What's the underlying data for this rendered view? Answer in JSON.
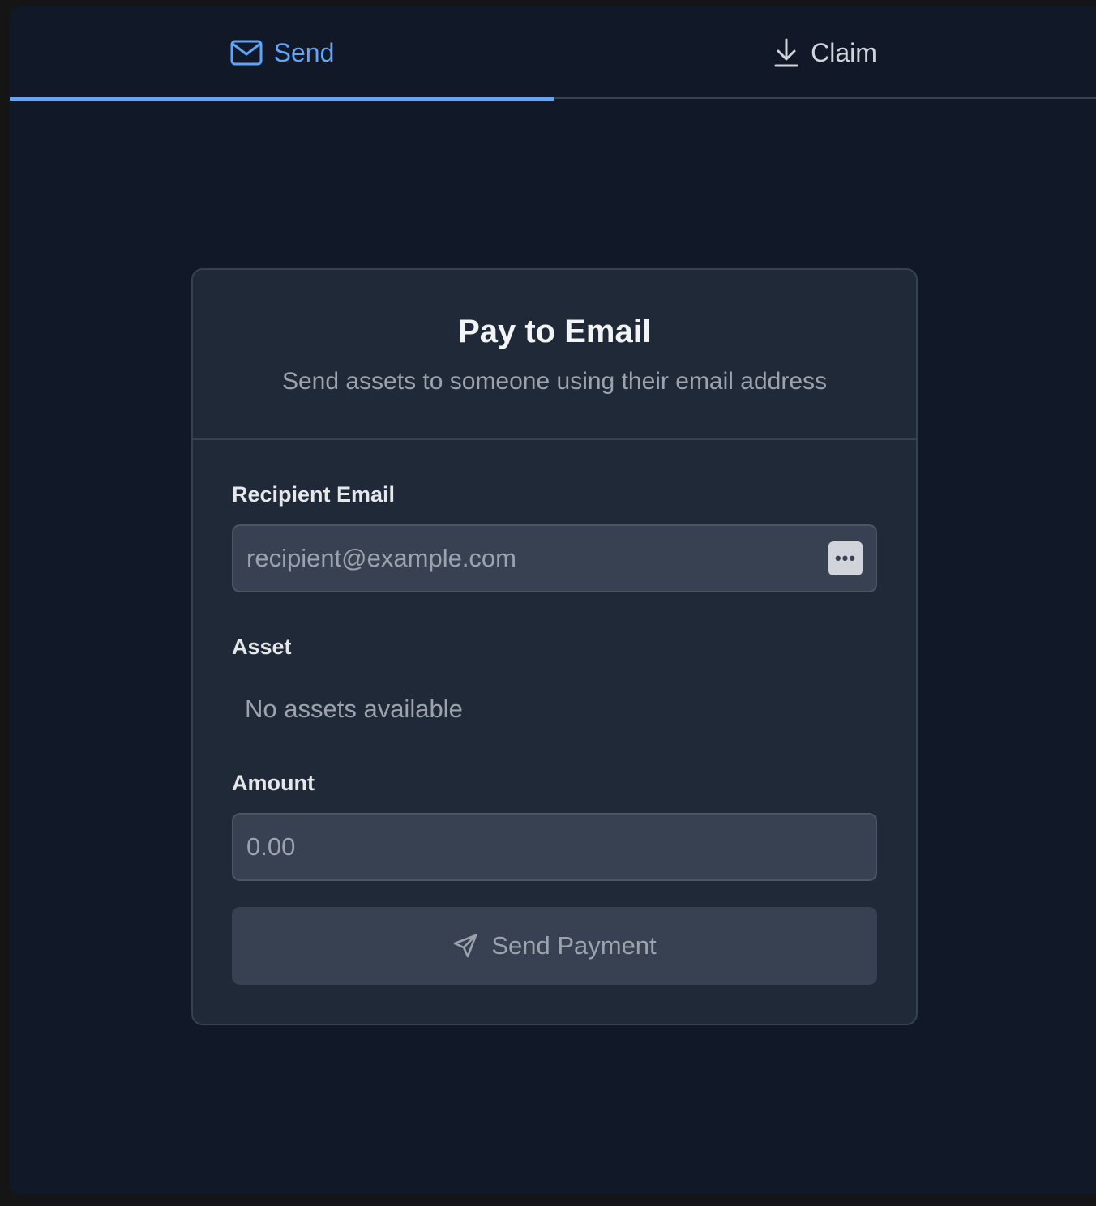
{
  "tabs": {
    "send": {
      "label": "Send",
      "icon": "mail-icon",
      "active": true
    },
    "claim": {
      "label": "Claim",
      "icon": "download-icon",
      "active": false
    }
  },
  "card": {
    "title": "Pay to Email",
    "description": "Send assets to someone using their email address"
  },
  "form": {
    "recipient_label": "Recipient Email",
    "recipient_placeholder": "recipient@example.com",
    "asset_label": "Asset",
    "asset_empty": "No assets available",
    "amount_label": "Amount",
    "amount_placeholder": "0.00",
    "submit_label": "Send Payment",
    "submit_icon": "send-icon"
  },
  "colors": {
    "accent": "#60a5fa",
    "background": "#111827",
    "card": "#1f2937"
  }
}
